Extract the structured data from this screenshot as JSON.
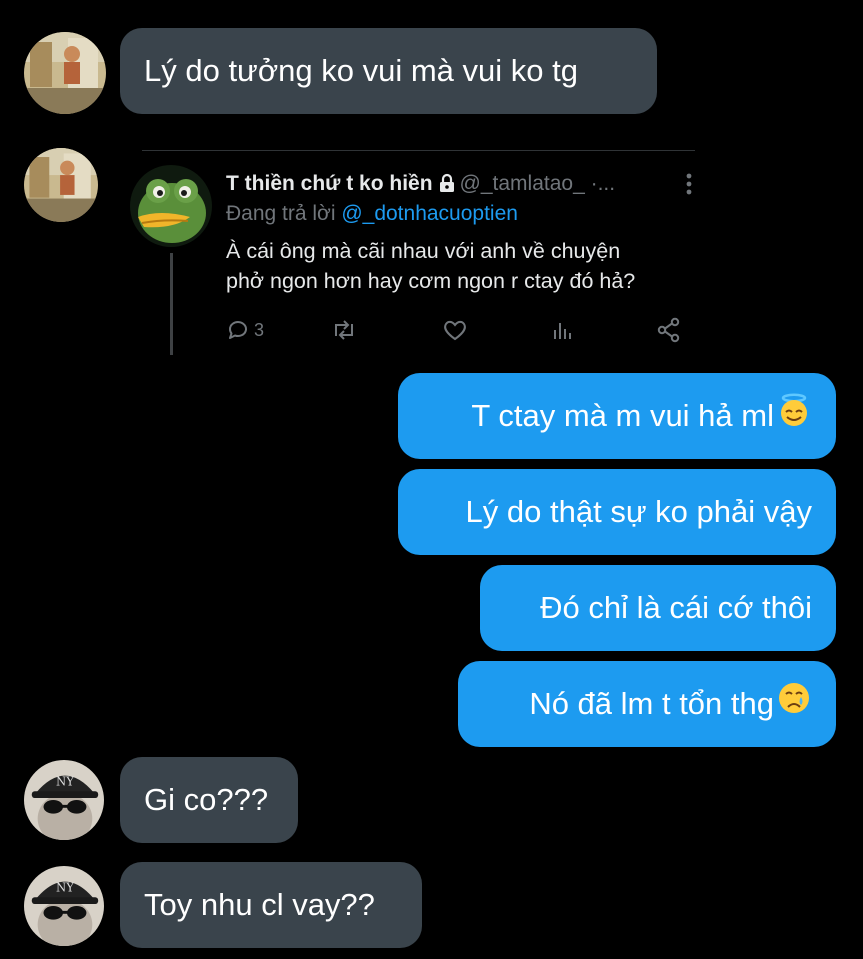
{
  "messages": {
    "m1": "Lý do tưởng ko vui mà vui ko tg",
    "m2": "T ctay mà m vui hả ml",
    "m3": "Lý do thật sự ko phải vậy",
    "m4": "Đó chỉ là cái cớ thôi",
    "m5": "Nó đã lm t tổn thg",
    "m6": "Gi co???",
    "m7": "Toy nhu cl vay??"
  },
  "tweet": {
    "name": "T thiền chứ t ko hiền",
    "handle": "@_tamlatao_ ·...",
    "replying_prefix": "Đang trả lời",
    "replying_to": "@_dotnhacuoptien",
    "text_line1": "À cái ông mà cãi nhau với anh về chuyện",
    "text_line2": "phở ngon hơn hay cơm ngon r ctay đó hả?",
    "reply_count": "3"
  },
  "icons": {
    "lock": "lock-icon",
    "more": "more-vertical-icon",
    "reply": "reply-icon",
    "retweet": "retweet-icon",
    "like": "heart-icon",
    "views": "views-icon",
    "share": "share-icon",
    "emoji_halo": "smiling-face-with-halo-emoji",
    "emoji_cry": "crying-face-emoji"
  },
  "colors": {
    "background": "#000000",
    "incoming_bubble": "#3a444c",
    "outgoing_bubble": "#1d9bf0",
    "link": "#1d9bf0",
    "muted": "#71767b"
  }
}
